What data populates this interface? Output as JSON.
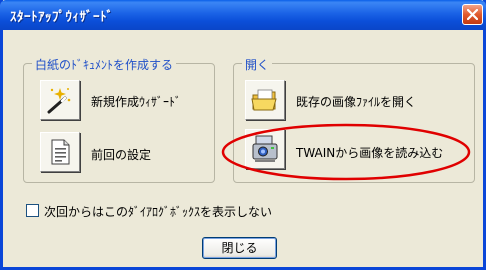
{
  "window": {
    "title": "ｽﾀｰﾄｱｯﾌﾟｳｨｻﾞｰﾄﾞ",
    "close_icon": "close-x-icon"
  },
  "group_new": {
    "title": "白紙のﾄﾞｷｭﾒﾝﾄを作成する",
    "items": [
      {
        "label": "新規作成ｳｨｻﾞｰﾄﾞ",
        "icon": "wizard-wand-icon"
      },
      {
        "label": "前回の設定",
        "icon": "document-settings-icon"
      }
    ]
  },
  "group_open": {
    "title": "開く",
    "items": [
      {
        "label": "既存の画像ﾌｧｲﾙを開く",
        "icon": "open-folder-icon"
      },
      {
        "label": "TWAINから画像を読み込む",
        "icon": "scanner-icon"
      }
    ]
  },
  "checkbox": {
    "label": "次回からはこのﾀﾞｲｱﾛｸﾞﾎﾞｯｸｽを表示しない",
    "checked": false
  },
  "footer": {
    "close_label": "閉じる"
  },
  "colors": {
    "titlebar": "#0a46d8",
    "dialog_bg": "#ece9d8",
    "group_title": "#2050c8",
    "highlight": "#e00000"
  }
}
